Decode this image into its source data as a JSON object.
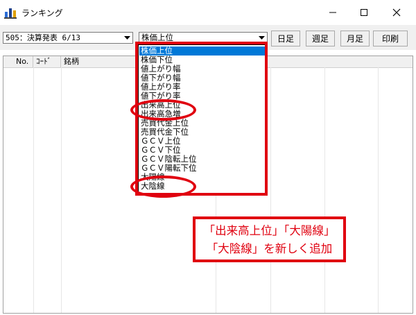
{
  "window": {
    "title": "ランキング"
  },
  "toolbar": {
    "period_select": "505：決算発表 6/13",
    "ranking_select": "株価上位",
    "buttons": [
      "日足",
      "週足",
      "月足",
      "印刷"
    ]
  },
  "list": {
    "columns": [
      "No.",
      "ｺｰﾄﾞ",
      "銘柄"
    ]
  },
  "dropdown": {
    "items": [
      "株価上位",
      "株価下位",
      "値上がり幅",
      "値下がり幅",
      "値上がり率",
      "値下がり率",
      "出来高上位",
      "出来高急増",
      "売買代金上位",
      "売買代金下位",
      "ＧＣＶ上位",
      "ＧＣＶ下位",
      "ＧＣＶ陰転上位",
      "ＧＣＶ陽転下位",
      "大陽線",
      "大陰線"
    ],
    "selected": 0
  },
  "callout": {
    "line1": "「出来高上位」「大陽線」",
    "line2": "「大陰線」を新しく追加"
  },
  "colors": {
    "accent": "#e0000f",
    "selection": "#0078d7"
  }
}
